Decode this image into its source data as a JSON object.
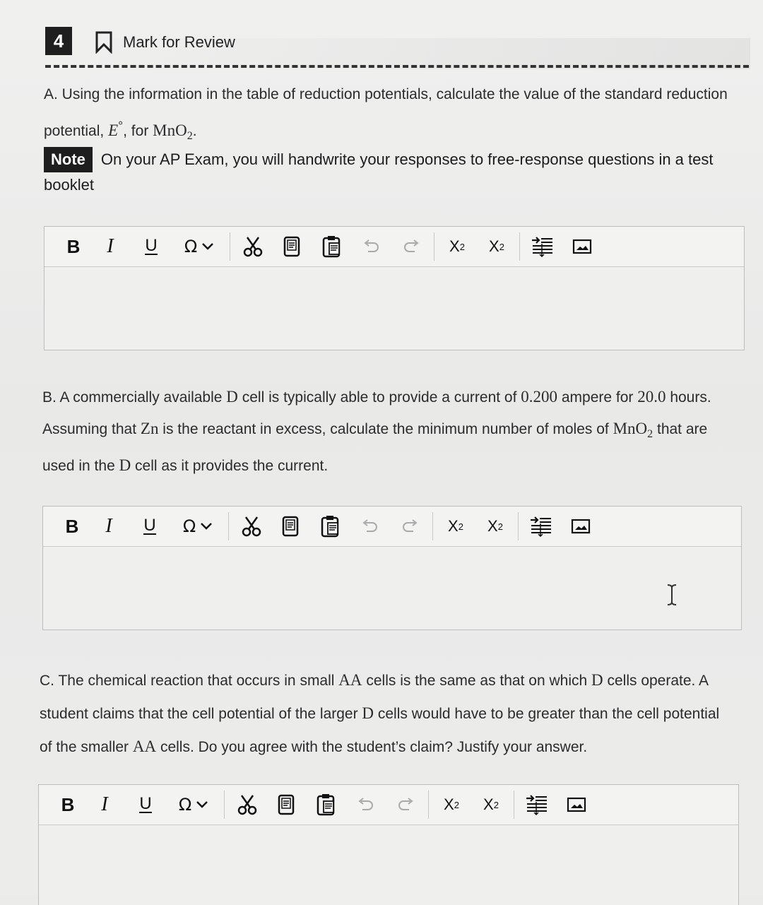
{
  "header": {
    "question_number": "4",
    "mark_for_review": "Mark for Review"
  },
  "part_a": {
    "line1": "A. Using the information in the table of reduction potentials, calculate the value of the standard reduction",
    "line2_pre": "potential, ",
    "symbol_E": "E",
    "degree": "°",
    "line2_mid": ", for ",
    "formula_base": "MnO",
    "formula_sub": "2",
    "line2_end": "."
  },
  "note": {
    "badge": "Note",
    "text": "On your AP Exam, you will handwrite your responses to free-response questions in a test booklet"
  },
  "toolbar": {
    "bold": "B",
    "italic": "I",
    "underline": "U",
    "omega": "Ω",
    "superscript_base": "X",
    "superscript_mark": "2",
    "subscript_base": "X",
    "subscript_mark": "2"
  },
  "part_b": {
    "l1a": "B. A commercially available ",
    "l1_D": "D",
    "l1b": " cell is typically able to provide a current of ",
    "l1_current": "0.200",
    "l1c": " ampere for ",
    "l1_hours": "20.0",
    "l1d": " hours.",
    "l2a": "Assuming that ",
    "l2_Zn": "Zn",
    "l2b": " is the reactant in excess, calculate the minimum number of moles of ",
    "l2_MnO": "MnO",
    "l2_sub": "2",
    "l2c": " that are",
    "l3a": "used in the ",
    "l3_D": "D",
    "l3b": " cell as it provides the current."
  },
  "part_c": {
    "l1a": "C. The chemical reaction that occurs in small ",
    "l1_AA": "AA",
    "l1b": " cells is the same as that on which ",
    "l1_D": "D",
    "l1c": " cells operate. A",
    "l2a": "student claims that the cell potential of the larger ",
    "l2_D": "D",
    "l2b": " cells would have to be greater than the cell potential",
    "l3a": "of the smaller ",
    "l3_AA": "AA",
    "l3b": " cells. Do you agree with the student’s claim? Justify your answer."
  },
  "icons": [
    "bookmark-icon",
    "chevron-down-icon",
    "scissors-icon",
    "copy-icon",
    "paste-icon",
    "undo-icon",
    "redo-icon",
    "indent-icon",
    "image-icon",
    "text-cursor-icon"
  ]
}
